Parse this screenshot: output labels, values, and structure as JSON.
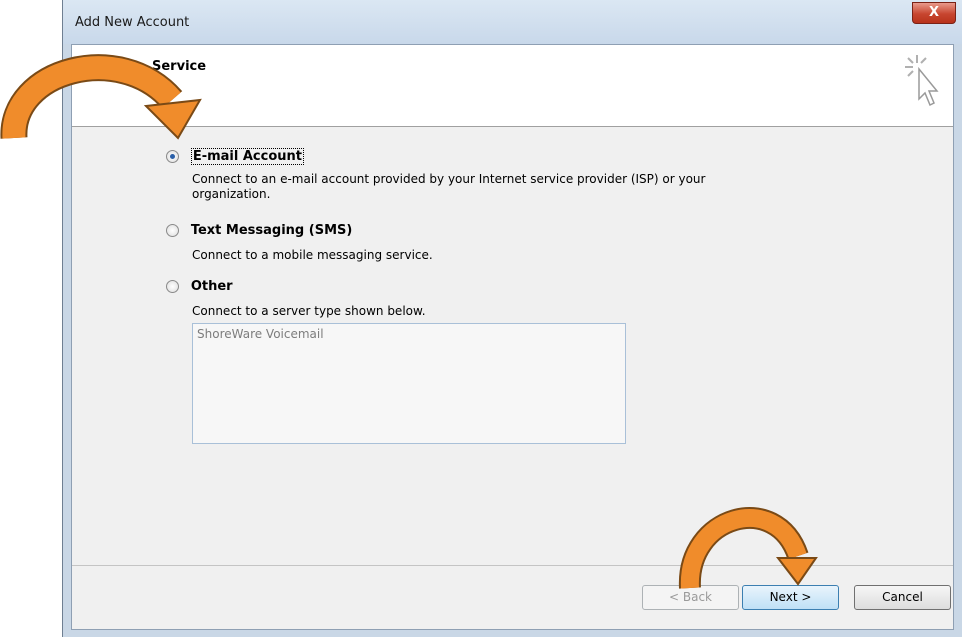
{
  "window": {
    "title": "Add New Account",
    "close_label": "X"
  },
  "header": {
    "title": "Service"
  },
  "options": [
    {
      "label": "E-mail Account",
      "checked": true,
      "description": "Connect to an e-mail account provided by your Internet service provider (ISP) or your organization."
    },
    {
      "label": "Text Messaging (SMS)",
      "checked": false,
      "description": "Connect to a mobile messaging service."
    },
    {
      "label": "Other",
      "checked": false,
      "description": "Connect to a server type shown below."
    }
  ],
  "server_types": {
    "items": [
      "ShoreWare Voicemail"
    ]
  },
  "buttons": {
    "back": "< Back",
    "next": "Next >",
    "cancel": "Cancel"
  },
  "icons": {
    "wizard": "click-cursor-icon",
    "annotation_arrow": "curved-arrow-icon"
  },
  "colors": {
    "annotation_arrow": "#f08c2b",
    "selected_radio": "#2a5fa8"
  }
}
